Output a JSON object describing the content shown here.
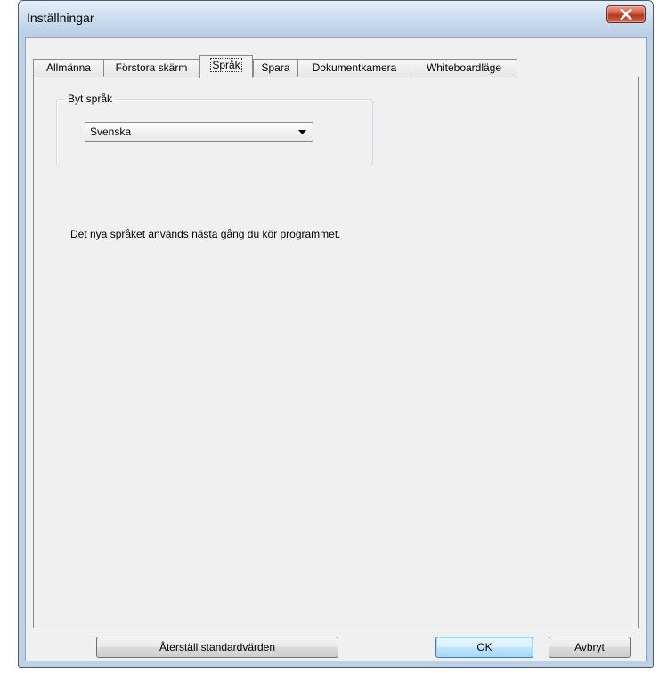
{
  "window": {
    "title": "Inställningar"
  },
  "tabs": [
    {
      "label": "Allmänna",
      "active": false
    },
    {
      "label": "Förstora skärm",
      "active": false
    },
    {
      "label": "Språk",
      "active": true
    },
    {
      "label": "Spara",
      "active": false
    },
    {
      "label": "Dokumentkamera",
      "active": false
    },
    {
      "label": "Whiteboardläge",
      "active": false
    }
  ],
  "language_group": {
    "label": "Byt språk",
    "selected_language": "Svenska"
  },
  "info_text": "Det nya språket används nästa gång du kör programmet.",
  "buttons": {
    "reset_label": "Återställ standardvärden",
    "ok_label": "OK",
    "cancel_label": "Avbryt"
  },
  "icons": {
    "close": "close-icon",
    "dropdown": "chevron-down-icon"
  },
  "colors": {
    "close_button": "#c8432b",
    "window_frame": "#bcd0e6",
    "client_bg": "#f0f0f0"
  }
}
